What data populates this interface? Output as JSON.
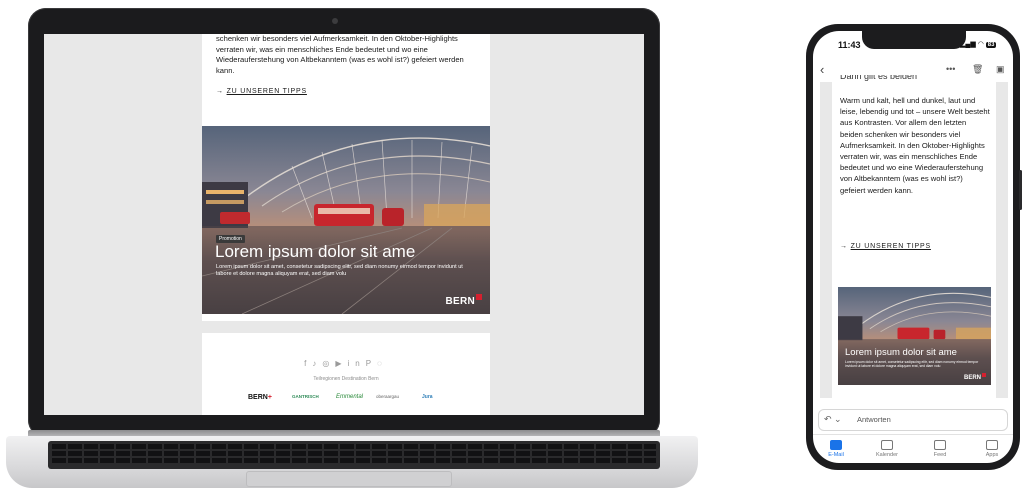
{
  "laptop": {
    "email": {
      "intro_text": "schenken wir besonders viel Aufmerksamkeit. In den Oktober-Highlights verraten wir, was ein menschliches Ende bedeutet und wo eine Wiederauferstehung von Altbekanntem (was es wohl ist?) gefeiert werden kann.",
      "tips_arrow": "→",
      "tips_label": "ZU UNSEREN TIPPS",
      "hero": {
        "badge": "Promotion",
        "title": "Lorem ipsum dolor sit ame",
        "body": "Lorem ipsum dolor sit amet, consetetur sadipscing elitr, sed diam nonumy eirmod tempor invidunt ut labore et dolore magna aliquyam erat, sed diam volu",
        "logo": "BERN"
      },
      "footer": {
        "social_icons": [
          "facebook-icon",
          "tiktok-icon",
          "instagram-icon",
          "youtube-icon",
          "linkedin-icon",
          "pinterest-icon",
          "whatsapp-icon"
        ],
        "regions_label": "Teilregionen Destination Bern",
        "partner_logos": [
          "BERN",
          "GANTRISCH",
          "Emmental",
          "oberaargau",
          "Jura"
        ]
      }
    }
  },
  "phone": {
    "status": {
      "time": "11:43",
      "battery": "83"
    },
    "subject_partial": "Dann gilt es beiden",
    "email": {
      "intro_text": "Warm und kalt, hell und dunkel, laut und leise, lebendig und tot – unsere Welt besteht aus Kontrasten. Vor allem den letzten beiden schenken wir besonders viel Aufmerksamkeit. In den Oktober-Highlights verraten wir, was ein menschliches Ende bedeutet und wo eine Wiederauferstehung von Altbekanntem (was es wohl ist?) gefeiert werden kann.",
      "tips_arrow": "→",
      "tips_label": "ZU UNSEREN TIPPS",
      "hero": {
        "title": "Lorem ipsum dolor sit ame",
        "body": "Lorem ipsum dolor sit amet, consetetur sadipscing elitr, sed diam nonumy eirmod tempor invidunt ut labore et dolore magna aliquyam erat, sed diam volu",
        "logo": "BERN"
      }
    },
    "reply_label": "Antworten",
    "tabs": [
      {
        "label": "E-Mail",
        "active": true
      },
      {
        "label": "Kalender",
        "active": false
      },
      {
        "label": "Feed",
        "active": false
      },
      {
        "label": "Apps",
        "active": false
      }
    ]
  },
  "colors": {
    "brand_red": "#d5202f",
    "tab_active": "#1a73e8",
    "email_bg": "#e8e8e8"
  }
}
